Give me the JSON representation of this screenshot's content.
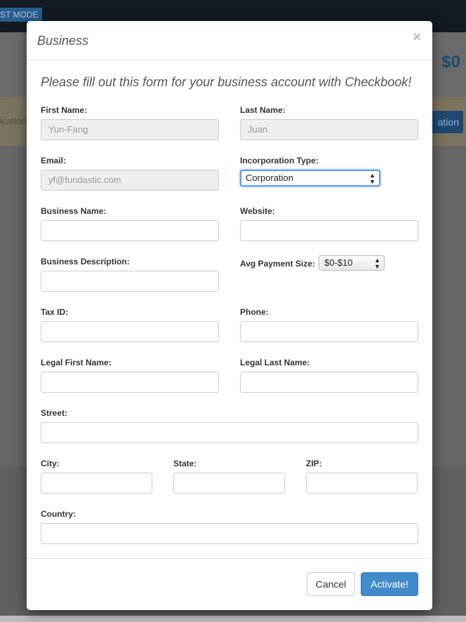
{
  "background": {
    "mode_badge": "ST MODE",
    "amount": "$0",
    "notice_fragment": "ication",
    "button_fragment": "ation"
  },
  "modal": {
    "title": "Business",
    "close_label": "×",
    "intro": "Please fill out this form for your business account with Checkbook!",
    "fields": {
      "first_name": {
        "label": "First Name:",
        "value": "Yun-Fang"
      },
      "last_name": {
        "label": "Last Name:",
        "value": "Juan"
      },
      "email": {
        "label": "Email:",
        "value": "yf@fundastic.com"
      },
      "incorporation_type": {
        "label": "Incorporation Type:",
        "value": "Corporation"
      },
      "business_name": {
        "label": "Business Name:",
        "value": ""
      },
      "website": {
        "label": "Website:",
        "value": ""
      },
      "business_description": {
        "label": "Business Description:",
        "value": ""
      },
      "avg_payment_size": {
        "label": "Avg Payment Size:",
        "value": "$0-$10"
      },
      "tax_id": {
        "label": "Tax ID:",
        "value": ""
      },
      "phone": {
        "label": "Phone:",
        "value": ""
      },
      "legal_first_name": {
        "label": "Legal First Name:",
        "value": ""
      },
      "legal_last_name": {
        "label": "Legal Last Name:",
        "value": ""
      },
      "street": {
        "label": "Street:",
        "value": ""
      },
      "city": {
        "label": "City:",
        "value": ""
      },
      "state": {
        "label": "State:",
        "value": ""
      },
      "zip": {
        "label": "ZIP:",
        "value": ""
      },
      "country": {
        "label": "Country:",
        "value": ""
      }
    },
    "buttons": {
      "cancel": "Cancel",
      "activate": "Activate!"
    }
  },
  "colors": {
    "primary": "#428bca",
    "focus_ring": "#5c9ded",
    "disabled_bg": "#eeeeee"
  }
}
